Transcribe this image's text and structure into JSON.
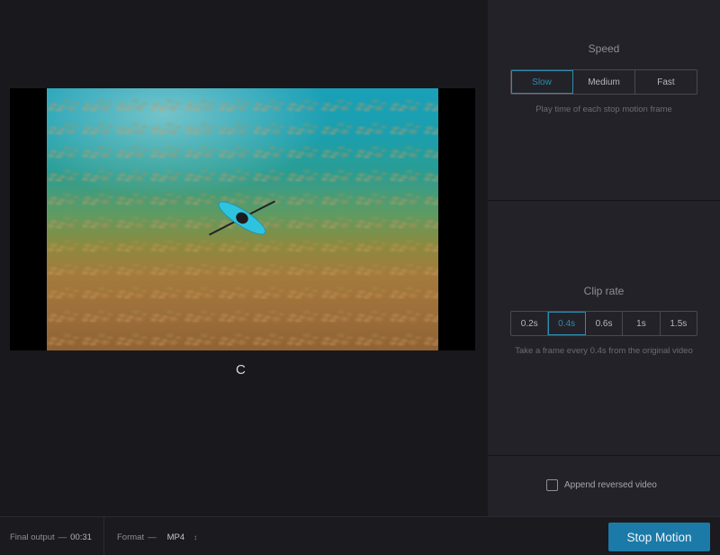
{
  "preview": {
    "loading_glyph": "C"
  },
  "speed": {
    "title": "Speed",
    "options": [
      "Slow",
      "Medium",
      "Fast"
    ],
    "selected": "Slow",
    "hint": "Play time of each stop motion frame"
  },
  "clip_rate": {
    "title": "Clip rate",
    "options": [
      "0.2s",
      "0.4s",
      "0.6s",
      "1s",
      "1.5s"
    ],
    "selected": "0.4s",
    "hint": "Take a frame every 0.4s from the original video"
  },
  "append": {
    "label": "Append reversed video",
    "checked": false
  },
  "bottom_bar": {
    "final_output_label": "Final output",
    "final_output_sep": "—",
    "final_output_value": "00:31",
    "format_label": "Format",
    "format_sep": "—",
    "format_value": "MP4",
    "action_button": "Stop Motion"
  },
  "colors": {
    "accent": "#1c7aa8",
    "selected_text": "#2c8cb1",
    "background": "#19181c",
    "sidebar": "#232228"
  }
}
